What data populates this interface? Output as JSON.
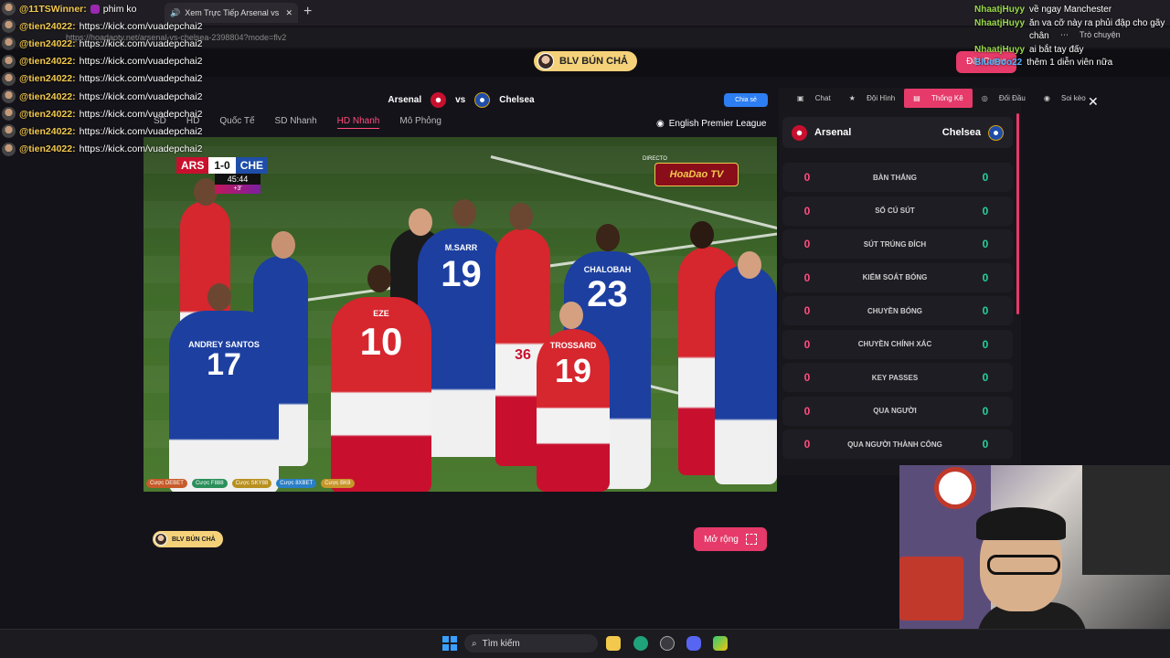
{
  "browser": {
    "tab_title": "Xem Trực Tiếp Arsenal vs Chelsea",
    "url": "https://hoadaotv.net/arsenal-vs-chelsea-2398804?mode=flv2",
    "new_tab": "+",
    "tab_close": "✕",
    "profile_label": "Trò chuyện"
  },
  "site": {
    "commentator": "BLV BÚN CHẢ",
    "bet_button": "Đặt Cược"
  },
  "match": {
    "home": "Arsenal",
    "away": "Chelsea",
    "vs": "vs",
    "share": "Chia sẻ",
    "league": "English Premier League",
    "quality_tabs": [
      "SD",
      "HD",
      "Quốc Tế",
      "SD Nhanh",
      "HD Nhanh",
      "Mô Phỏng"
    ],
    "active_quality": "HD Nhanh"
  },
  "video": {
    "home_abbr": "ARS",
    "away_abbr": "CHE",
    "score": "1-0",
    "clock": "45:44",
    "added_time": "+3'",
    "directo": "DIRECTO",
    "broadcaster": "HoaDao TV",
    "jerseys": {
      "p1": "17",
      "p1_name": "ANDREY SANTOS",
      "p2": "19",
      "p2_name": "M.SARR",
      "p3": "10",
      "p3_name": "EZE",
      "p4": "23",
      "p4_name": "CHALOBAH",
      "p5": "19",
      "p5_name": "TROSSARD",
      "p6": "36"
    },
    "bet_links": [
      {
        "label": "Cược DEBET",
        "color": "#c75b2a"
      },
      {
        "label": "Cược F888",
        "color": "#2a8f5a"
      },
      {
        "label": "Cược SKY88",
        "color": "#b89020"
      },
      {
        "label": "Cược 8XBET",
        "color": "#2a7fc7"
      },
      {
        "label": "Cược BK8",
        "color": "#c7962a"
      }
    ]
  },
  "stats_panel": {
    "tabs": [
      "Chat",
      "Đội Hình",
      "Thống Kê",
      "Đối Đầu",
      "Soi kèo"
    ],
    "active_tab": "Thống Kê",
    "close": "✕",
    "home": "Arsenal",
    "away": "Chelsea",
    "rows": [
      {
        "name": "BÀN THẮNG",
        "home": "0",
        "away": "0"
      },
      {
        "name": "SỐ CÚ SÚT",
        "home": "0",
        "away": "0"
      },
      {
        "name": "SÚT TRÚNG ĐÍCH",
        "home": "0",
        "away": "0"
      },
      {
        "name": "KIỂM SOÁT BÓNG",
        "home": "0",
        "away": "0"
      },
      {
        "name": "CHUYỀN BÓNG",
        "home": "0",
        "away": "0"
      },
      {
        "name": "CHUYỀN CHÍNH XÁC",
        "home": "0",
        "away": "0"
      },
      {
        "name": "KEY PASSES",
        "home": "0",
        "away": "0"
      },
      {
        "name": "QUA NGƯỜI",
        "home": "0",
        "away": "0"
      },
      {
        "name": "QUA NGƯỜI THÀNH CÔNG",
        "home": "0",
        "away": "0"
      }
    ]
  },
  "bottom": {
    "commentator": "BLV BÚN CHẢ",
    "expand": "Mở rộng"
  },
  "chat_left": [
    {
      "user": "@11TSWinner:",
      "msg": "phim ko"
    },
    {
      "user": "@tien24022:",
      "msg": "https://kick.com/vuadepchai2"
    },
    {
      "user": "@tien24022:",
      "msg": "https://kick.com/vuadepchai2"
    },
    {
      "user": "@tien24022:",
      "msg": "https://kick.com/vuadepchai2"
    },
    {
      "user": "@tien24022:",
      "msg": "https://kick.com/vuadepchai2"
    },
    {
      "user": "@tien24022:",
      "msg": "https://kick.com/vuadepchai2"
    },
    {
      "user": "@tien24022:",
      "msg": "https://kick.com/vuadepchai2"
    },
    {
      "user": "@tien24022:",
      "msg": "https://kick.com/vuadepchai2"
    },
    {
      "user": "@tien24022:",
      "msg": "https://kick.com/vuadepchai2"
    }
  ],
  "chat_right": [
    {
      "user": "NhaatjHuyy",
      "msg": "về ngay Manchester"
    },
    {
      "user": "NhaatjHuyy",
      "msg": "ăn va cỡ này ra phủi đập cho gãy chân"
    },
    {
      "user": "NhaatjHuyy",
      "msg": "ai bắt tay đấy"
    },
    {
      "user": "BlueBoo22",
      "msg": "thêm 1 diễn viên nữa"
    }
  ],
  "taskbar": {
    "search": "Tìm kiếm"
  },
  "colors": {
    "accent": "#e53a6a",
    "home_stat": "#ff4d7e",
    "away_stat": "#25d0a0",
    "commentator_badge": "#f5d27a"
  }
}
